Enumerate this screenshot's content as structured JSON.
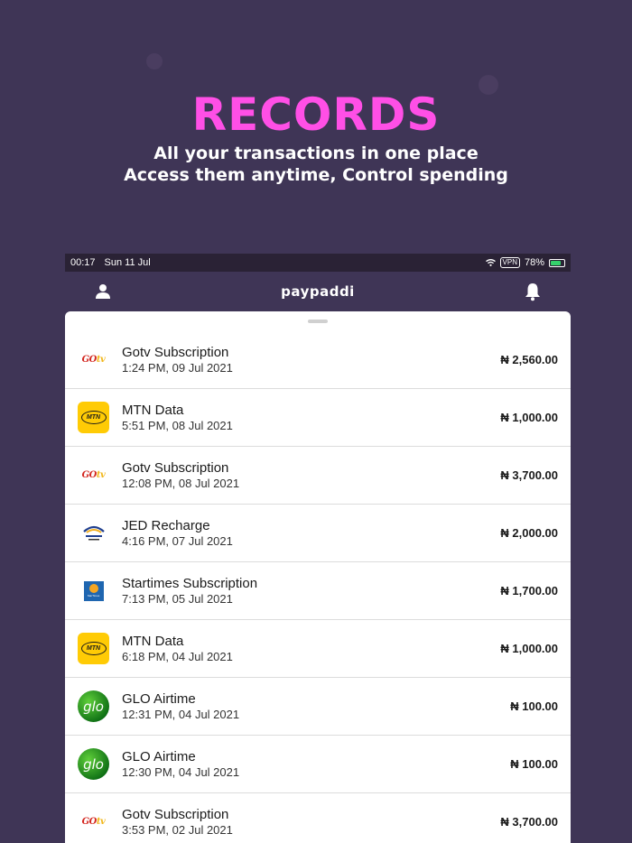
{
  "hero": {
    "title": "RECORDS",
    "subtitle_line1": "All your transactions in one place",
    "subtitle_line2": "Access them anytime, Control spending"
  },
  "status_bar": {
    "time": "00:17",
    "date": "Sun 11 Jul",
    "vpn": "VPN",
    "battery": "78%",
    "battery_level": 0.78
  },
  "navbar": {
    "brand": "paypaddi",
    "left_icon": "user-icon",
    "right_icon": "bell-icon"
  },
  "colors": {
    "background": "#3f3556",
    "accent": "#ff4fe6",
    "sheet": "#ffffff"
  },
  "transactions": [
    {
      "logo": "gotv",
      "name": "Gotv Subscription",
      "time": "1:24 PM, 09 Jul 2021",
      "amount": "₦ 2,560.00"
    },
    {
      "logo": "mtn",
      "name": "MTN Data",
      "time": "5:51 PM, 08 Jul 2021",
      "amount": "₦ 1,000.00"
    },
    {
      "logo": "gotv",
      "name": "Gotv Subscription",
      "time": "12:08 PM, 08 Jul 2021",
      "amount": "₦ 3,700.00"
    },
    {
      "logo": "jed",
      "name": "JED Recharge",
      "time": "4:16 PM, 07 Jul 2021",
      "amount": "₦ 2,000.00"
    },
    {
      "logo": "startimes",
      "name": "Startimes Subscription",
      "time": "7:13 PM, 05 Jul 2021",
      "amount": "₦ 1,700.00"
    },
    {
      "logo": "mtn",
      "name": "MTN Data",
      "time": "6:18 PM, 04 Jul 2021",
      "amount": "₦ 1,000.00"
    },
    {
      "logo": "glo",
      "name": "GLO Airtime",
      "time": "12:31 PM, 04 Jul 2021",
      "amount": "₦ 100.00"
    },
    {
      "logo": "glo",
      "name": "GLO Airtime",
      "time": "12:30 PM, 04 Jul 2021",
      "amount": "₦ 100.00"
    },
    {
      "logo": "gotv",
      "name": "Gotv Subscription",
      "time": "3:53 PM, 02 Jul 2021",
      "amount": "₦ 3,700.00"
    }
  ]
}
